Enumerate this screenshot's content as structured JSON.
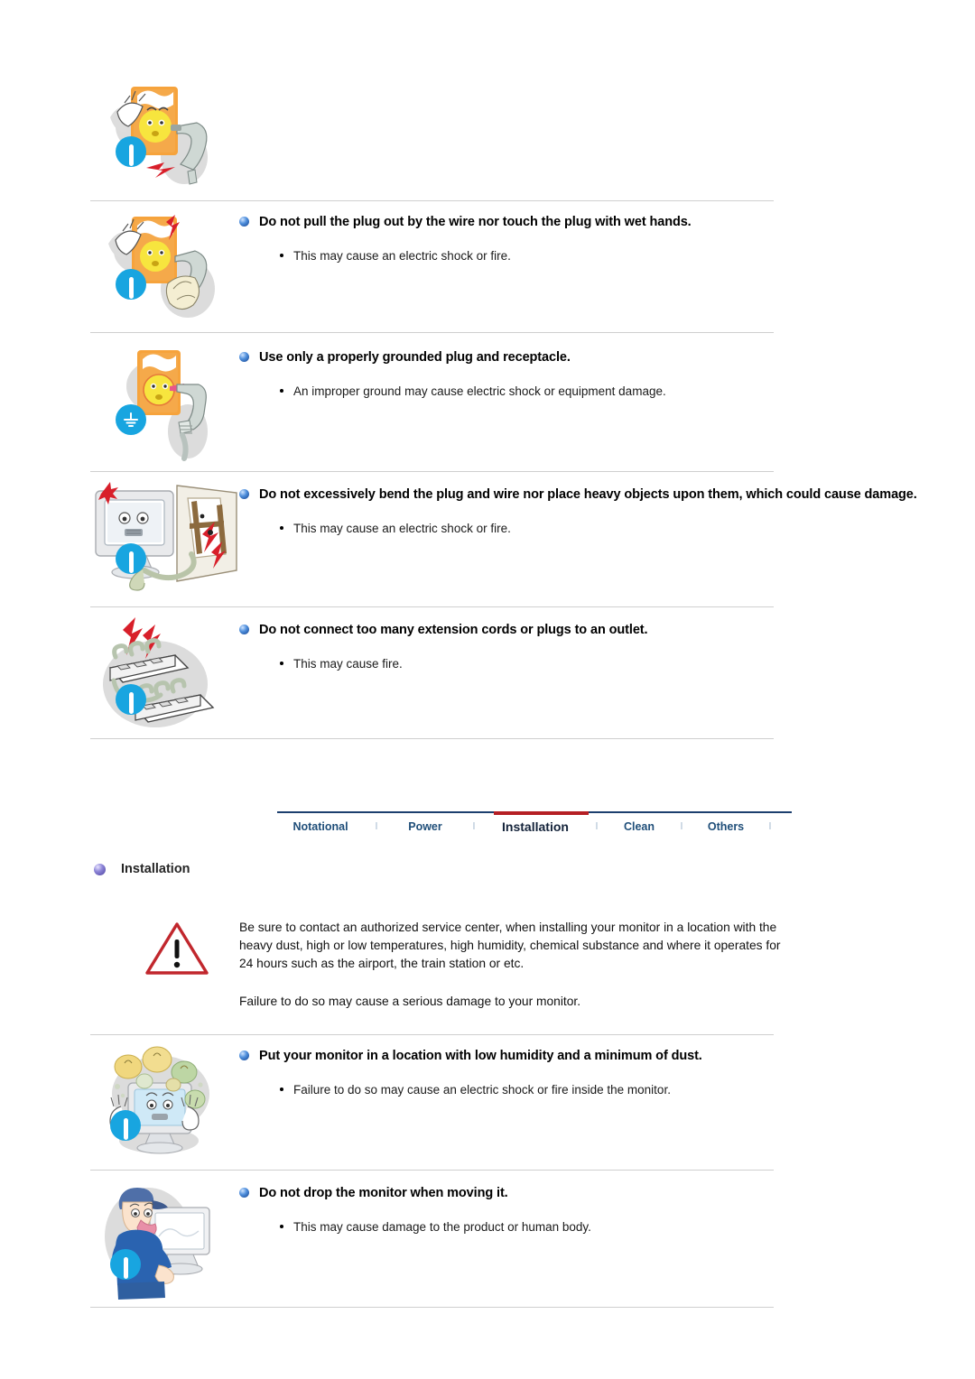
{
  "document": {
    "sections": [
      {
        "id": "pull-plug",
        "illustration": "outlet-face-plug-pull-icon",
        "status_icon": "exclamation-icon",
        "heading": "Do not pull the plug out by the wire nor touch the plug with wet hands.",
        "items": [
          "This may cause an electric shock or fire."
        ]
      },
      {
        "id": "grounded-plug",
        "illustration": "outlet-face-grounded-plug-icon",
        "status_icon": "ground-icon",
        "heading": "Use only a properly grounded plug and receptacle.",
        "items": [
          "An improper ground may cause electric shock or equipment damage."
        ]
      },
      {
        "id": "bend-plug",
        "illustration": "monitor-bent-cable-icon",
        "status_icon": "exclamation-icon",
        "heading": "Do not excessively bend the plug and wire nor place heavy objects upon them, which could cause damage.",
        "items": [
          "This may cause an electric shock or fire."
        ]
      },
      {
        "id": "extension-cords",
        "illustration": "overloaded-power-strip-icon",
        "status_icon": "exclamation-icon",
        "heading": "Do not connect too many extension cords or plugs to an outlet.",
        "items": [
          "This may cause fire."
        ]
      }
    ],
    "tabs": {
      "items": [
        {
          "label": "Notational",
          "active": false
        },
        {
          "label": "Power",
          "active": false
        },
        {
          "label": "Installation",
          "active": true
        },
        {
          "label": "Clean",
          "active": false
        },
        {
          "label": "Others",
          "active": false
        }
      ],
      "separator": "l",
      "accent_color": "#b51f24",
      "line_color": "#1c3f6e",
      "link_color": "#1f4e79"
    },
    "section_title": "Installation",
    "warning": {
      "icon": "warning-triangle-icon",
      "paragraphs": [
        "Be sure to contact an authorized service center, when installing your monitor in a location with the heavy dust, high or low temperatures, high humidity, chemical substance and where it operates for 24 hours such as the airport, the train station or etc.",
        "Failure to do so may cause a serious damage to your monitor."
      ]
    },
    "sections2": [
      {
        "id": "low-humidity",
        "illustration": "monitor-dust-particles-icon",
        "status_icon": "exclamation-icon",
        "heading": "Put your monitor in a location with low humidity and a minimum of dust.",
        "items": [
          "Failure to do so may cause an electric shock or fire inside the monitor."
        ]
      },
      {
        "id": "do-not-drop",
        "illustration": "person-carrying-monitor-icon",
        "status_icon": "exclamation-icon",
        "heading": "Do not drop the monitor when moving it.",
        "items": [
          "This may cause damage to the product or human body."
        ]
      }
    ]
  }
}
